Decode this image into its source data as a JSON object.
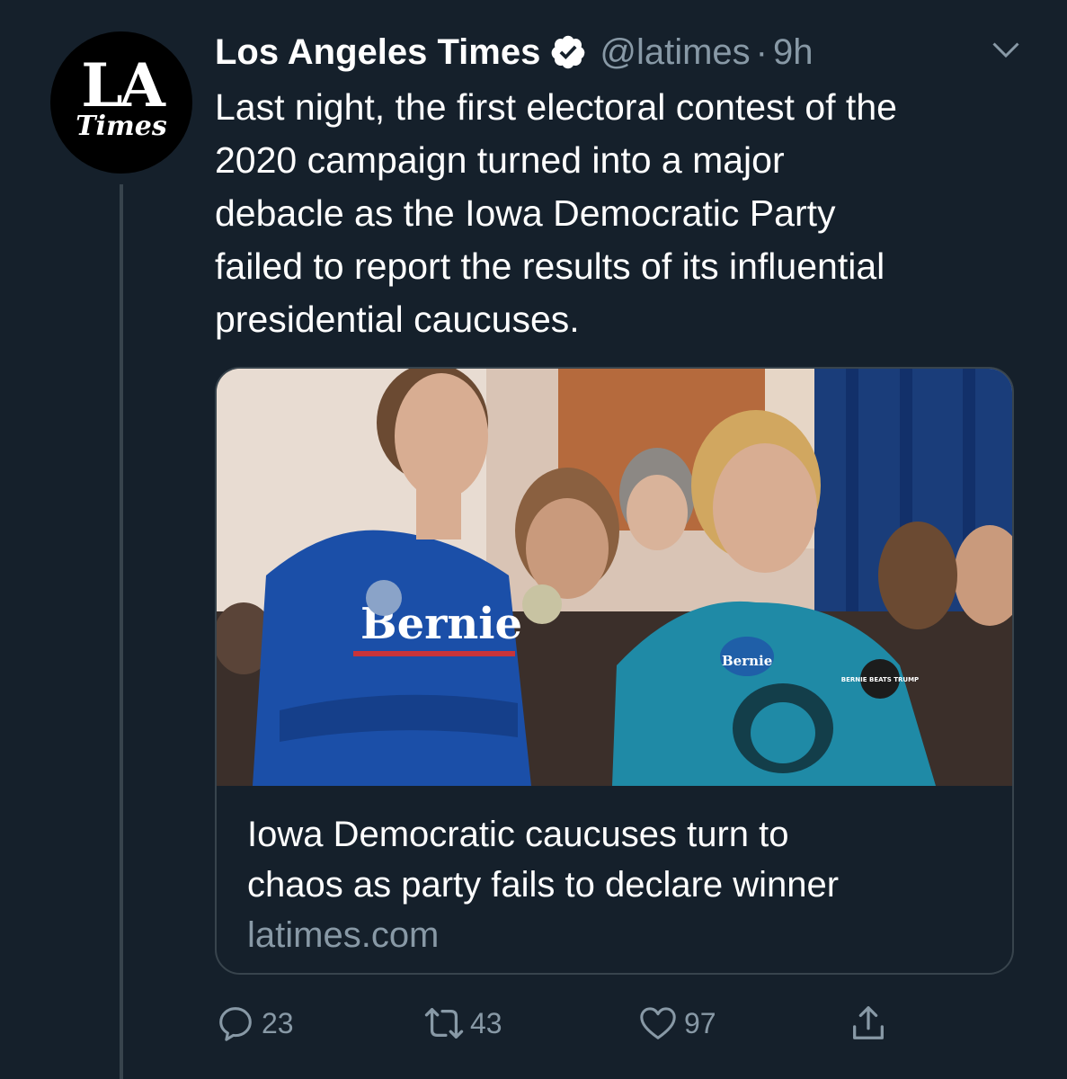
{
  "tweet": {
    "author_name": "Los Angeles Times",
    "handle": "@latimes",
    "separator": "·",
    "time": "9h",
    "text": "Last night, the first electoral contest of the\n2020 campaign turned into a major\ndebacle as the Iowa Democratic Party\nfailed to report the results of its influential\npresidential caucuses."
  },
  "avatar": {
    "line1": "LA",
    "line2": "Times"
  },
  "card": {
    "title": "Iowa Democratic caucuses turn to\nchaos as party fails to declare winner",
    "domain": "latimes.com",
    "image_labels": {
      "shirt_left": "Bernie",
      "button_right": "Bernie",
      "pin_right": "BERNIE BEATS TRUMP"
    }
  },
  "actions": {
    "reply_count": "23",
    "retweet_count": "43",
    "like_count": "97"
  },
  "icons": {
    "verified": "verified-badge-icon",
    "chevron": "chevron-down-icon",
    "reply": "reply-icon",
    "retweet": "retweet-icon",
    "like": "heart-icon",
    "share": "share-icon"
  },
  "colors": {
    "background": "#15202b",
    "secondary_text": "#8899a6",
    "border": "#38444d",
    "primary_text": "#ffffff"
  }
}
